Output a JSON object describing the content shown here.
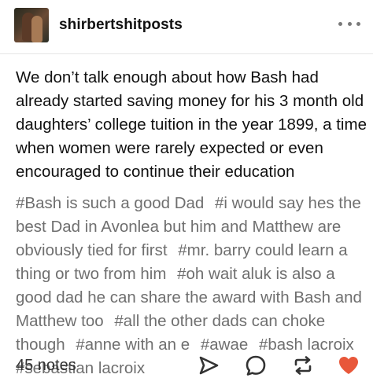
{
  "post": {
    "username": "shirbertshitposts",
    "body": "We don’t talk enough about how Bash had already started saving money for his 3 month old daughters’ college tuition in the year 1899, a time when women were rarely expected or even encouraged to continue their education",
    "tags": [
      "#Bash is such a good Dad",
      "#i would say hes the best Dad in Avonlea but him and Matthew are obviously tied for first",
      "#mr. barry could learn a thing or two from him",
      "#oh wait aluk is also a good dad he can share the award with Bash and Matthew too",
      "#all the other dads can choke though",
      "#anne with an e",
      "#awae",
      "#bash lacroix",
      "#sebastian lacroix"
    ],
    "notes": "45 notes"
  },
  "icons": {
    "more": "more-options-icon",
    "share": "share-icon",
    "reply": "reply-icon",
    "reblog": "reblog-icon",
    "like": "heart-icon"
  },
  "colors": {
    "text": "#111111",
    "tags": "#6f6f6f",
    "like": "#e8573a",
    "icons": "#333333"
  }
}
